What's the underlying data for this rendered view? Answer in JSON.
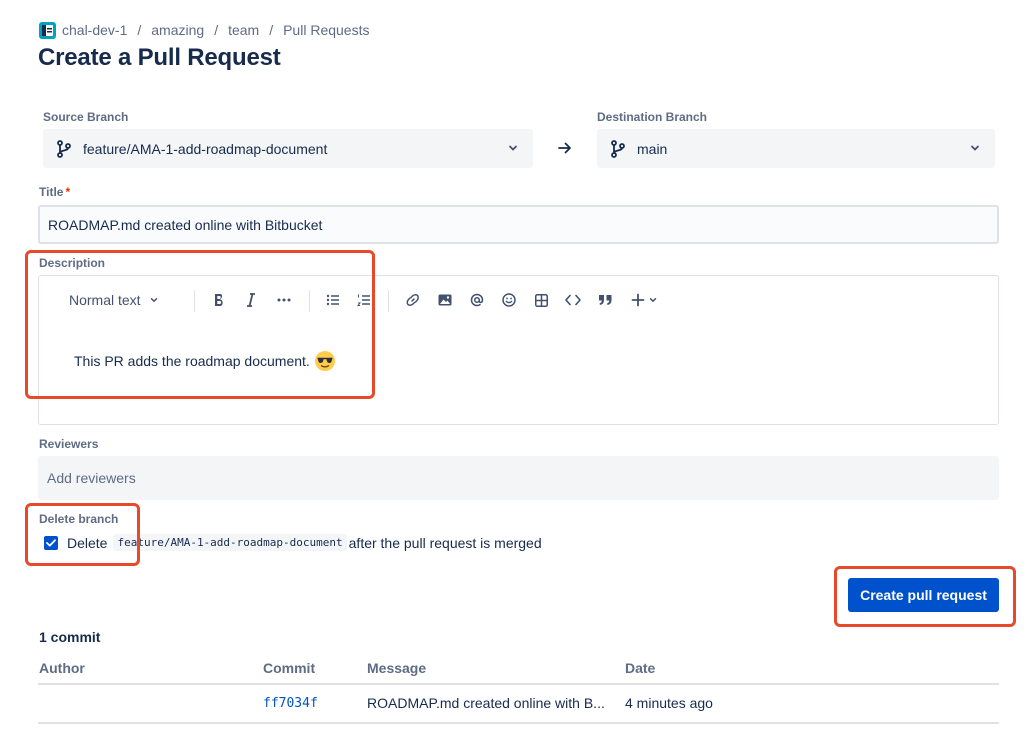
{
  "breadcrumb": {
    "items": [
      "chal-dev-1",
      "amazing",
      "team",
      "Pull Requests"
    ],
    "separator": "/"
  },
  "page": {
    "title": "Create a Pull Request"
  },
  "source": {
    "label": "Source Branch",
    "value": "feature/AMA-1-add-roadmap-document"
  },
  "destination": {
    "label": "Destination Branch",
    "value": "main"
  },
  "title_field": {
    "label": "Title",
    "required_mark": "*",
    "value": "ROADMAP.md created online with Bitbucket"
  },
  "description": {
    "label": "Description",
    "toolbar": {
      "text_style": "Normal text"
    },
    "content": "This PR adds the roadmap document.",
    "emoji": "sunglasses-emoji"
  },
  "reviewers": {
    "label": "Reviewers",
    "placeholder": "Add reviewers"
  },
  "delete_branch": {
    "label": "Delete branch",
    "checked": true,
    "text_before": "Delete",
    "branch": "feature/AMA-1-add-roadmap-document",
    "text_after": "after the pull request is merged"
  },
  "submit": {
    "label": "Create pull request"
  },
  "commits": {
    "count_label": "1 commit",
    "columns": [
      "Author",
      "Commit",
      "Message",
      "Date"
    ],
    "rows": [
      {
        "author": "",
        "commit": "ff7034f",
        "message": "ROADMAP.md created online with B...",
        "date": "4 minutes ago"
      }
    ]
  },
  "colors": {
    "primary": "#0052cc",
    "highlight": "#e8492b",
    "required": "#de350b"
  }
}
